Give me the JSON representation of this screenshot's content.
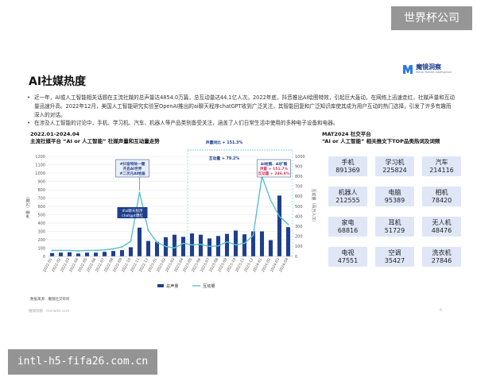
{
  "watermarks": {
    "top": "世界杯公司",
    "bottom": "intl-h5-fifa26.com.cn"
  },
  "header": {
    "title": "AI社媒热度",
    "brand": {
      "name": "魔镜洞察",
      "sub": "Mirror Market Intelligence",
      "mark_color": "#2f7be0"
    }
  },
  "bullets": [
    "近一年，AI或人工智能相关话题在主流社媒的总声量达4854.0万篇，总互动量达44.1亿人次。2022年底，抖音推出AI绘图特效，引起巨大轰动，在网络上迅速走红，社媒声量和互动量迅速升高。2022年12月，美国人工智能研究实验室OpenAI推出的ai聊天程序chatGPT收到广泛关注，其智能回复和广泛知识库使其成为用户互动的热门选择，引发了许多有趣而深入的对话。",
    "在涉及人工智能的讨论中，手机、学习机、汽车、机器人等产品类别备受关注，涵盖了人们日常生活中使用的多种电子设备和电器。"
  ],
  "chart_section": {
    "period": "2022.01-2024.04",
    "title": "主流社媒平台 “AI or 人工智能” 社媒声量和互动量走势"
  },
  "chart_data": {
    "type": "bar",
    "categories": [
      "2022-01",
      "2022-02",
      "2022-03",
      "2022-04",
      "2022-05",
      "2022-06",
      "2022-07",
      "2022-08",
      "2022-09",
      "2022-10",
      "2022-11",
      "2022-12",
      "2023-01",
      "2023-02",
      "2023-03",
      "2023-04",
      "2023-05",
      "2023-06",
      "2023-07",
      "2023-08",
      "2023-09",
      "2023-10",
      "2023-11",
      "2023-12",
      "2024-01",
      "2024-02",
      "2024-03",
      "2024-04"
    ],
    "series": [
      {
        "name": "总声量",
        "kind": "bar",
        "axis": "left",
        "color": "#1f3f8c",
        "values": [
          40,
          45,
          50,
          35,
          45,
          45,
          55,
          65,
          75,
          110,
          345,
          185,
          175,
          230,
          260,
          235,
          275,
          260,
          215,
          245,
          270,
          310,
          265,
          300,
          300,
          195,
          730,
          350
        ]
      },
      {
        "name": "互动量",
        "kind": "line",
        "axis": "right",
        "color": "#59bed3",
        "values": [
          60,
          60,
          60,
          55,
          60,
          60,
          65,
          75,
          95,
          150,
          640,
          260,
          140,
          100,
          85,
          130,
          115,
          120,
          100,
          105,
          145,
          115,
          130,
          210,
          800,
          560,
          400,
          320
        ]
      }
    ],
    "ylim_left": [
      0,
      1200
    ],
    "yticks_left": [
      0,
      100,
      200,
      300,
      400,
      500,
      600,
      700,
      800,
      900,
      1000,
      1100,
      1200
    ],
    "ylabel_left": "声量（万篇）",
    "ylim_right": [
      0,
      1000
    ],
    "yticks_right": [
      0,
      100,
      200,
      300,
      400,
      500,
      600,
      700,
      800,
      900,
      1000
    ],
    "ylabel_right": "互动量（百万人次）",
    "legend": [
      "总声量",
      "互动量"
    ],
    "annotations": [
      {
        "lines": [
          "#抖音特效一键",
          "开启AI世界",
          "#二次元AI绘画"
        ],
        "at": "2022-11"
      },
      {
        "lines": [
          "#ai聊天程序",
          "chatgpt爆红"
        ],
        "at": "2022-11"
      },
      {
        "lines": [
          "声量同比 + 151.3%",
          "互动量 + 79.2%"
        ],
        "span": [
          "2023-05",
          "2024-04"
        ]
      },
      {
        "lines": [
          "AI绘图、AI扩图",
          "声量 + 151.7%",
          "互动量 + 246.8%"
        ],
        "at": "2024-01"
      }
    ]
  },
  "right_section": {
    "title": "MAT2024 社交平台",
    "subtitle": "“AI or 人工智能” 相关推文下TOP品类热词及词频",
    "products": [
      {
        "name": "手机",
        "value": "891369"
      },
      {
        "name": "学习机",
        "value": "225824"
      },
      {
        "name": "汽车",
        "value": "214116"
      },
      {
        "name": "机器人",
        "value": "212555"
      },
      {
        "name": "电脑",
        "value": "95389"
      },
      {
        "name": "相机",
        "value": "78420"
      },
      {
        "name": "家电",
        "value": "68816"
      },
      {
        "name": "耳机",
        "value": "51729"
      },
      {
        "name": "无人机",
        "value": "48476"
      },
      {
        "name": "电视",
        "value": "47551"
      },
      {
        "name": "空调",
        "value": "35427"
      },
      {
        "name": "洗衣机",
        "value": "27846"
      }
    ]
  },
  "footer": {
    "source": "数据来源：魔镜社交聆听",
    "left": "魔镜洞察 · mirrorbi.com",
    "page": "6"
  }
}
